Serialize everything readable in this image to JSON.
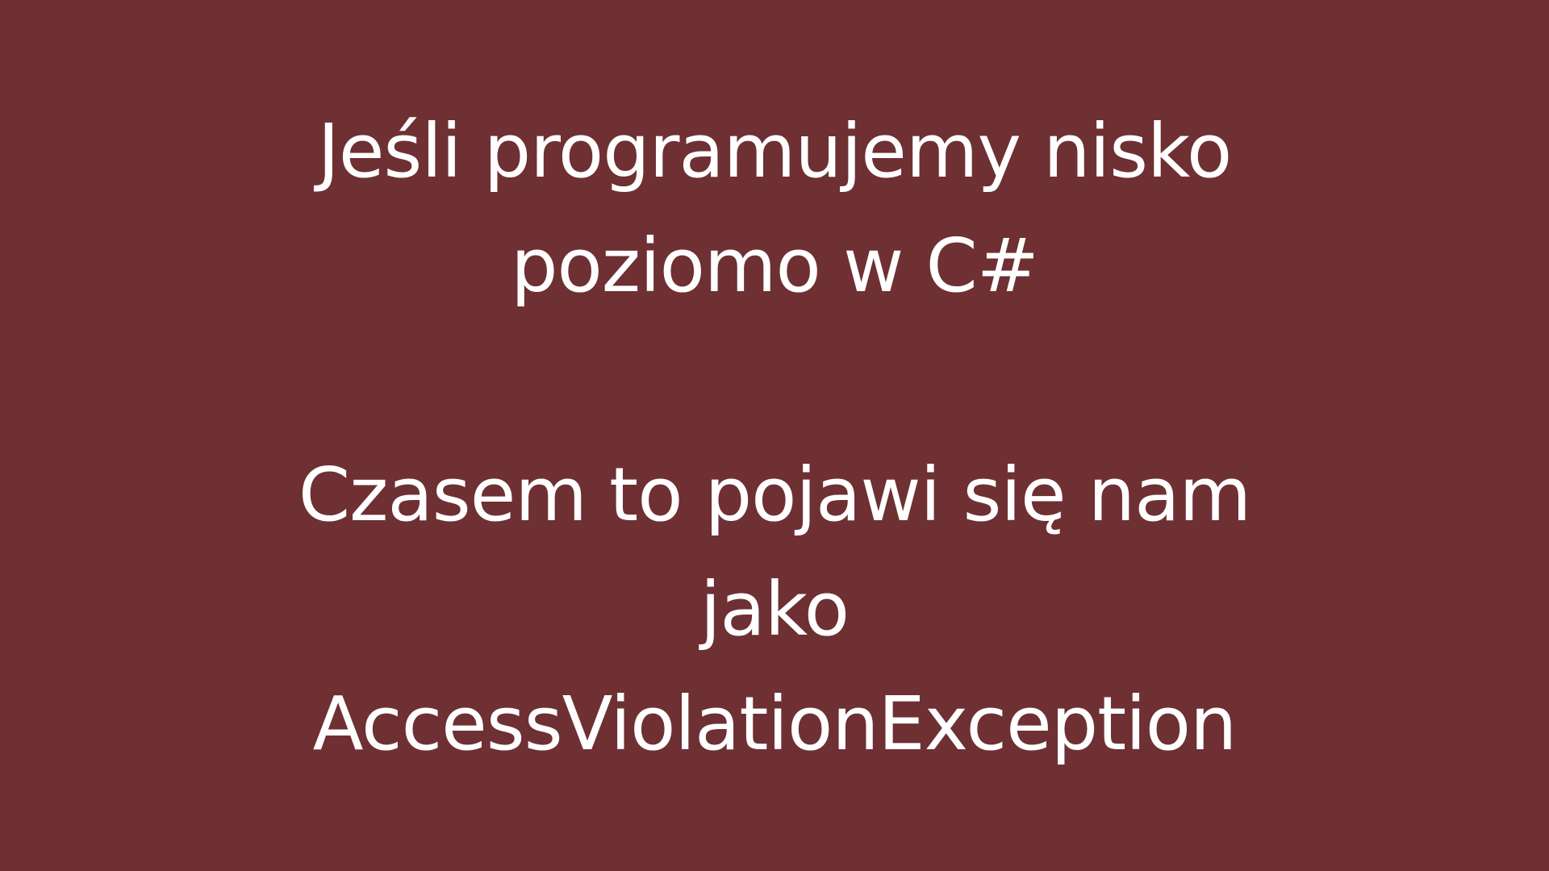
{
  "slide": {
    "background_color": "#6e3033",
    "text_color": "#ffffff",
    "heading": {
      "line1": "Jeśli programujemy nisko",
      "line2": "poziomo w C#"
    },
    "message": {
      "line1": "Czasem to pojawi się nam",
      "line2": "jako",
      "line3": "AccessViolationException"
    }
  }
}
